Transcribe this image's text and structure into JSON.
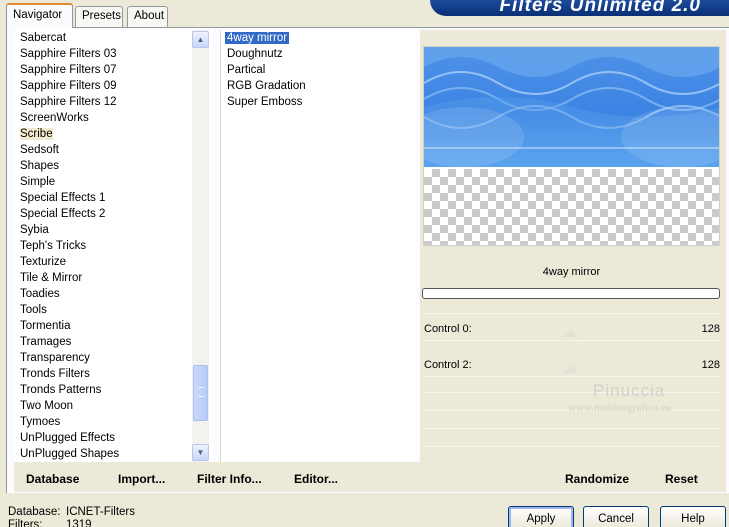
{
  "app": {
    "title": "Filters Unlimited 2.0"
  },
  "tabs": [
    {
      "label": "Navigator",
      "active": true
    },
    {
      "label": "Presets",
      "active": false
    },
    {
      "label": "About",
      "active": false
    }
  ],
  "categories": {
    "selected": "Scribe",
    "items": [
      "Sabercat",
      "Sapphire Filters 03",
      "Sapphire Filters 07",
      "Sapphire Filters 09",
      "Sapphire Filters 12",
      "ScreenWorks",
      "Scribe",
      "Sedsoft",
      "Shapes",
      "Simple",
      "Special Effects 1",
      "Special Effects 2",
      "Sybia",
      "Teph's Tricks",
      "Texturize",
      "Tile & Mirror",
      "Toadies",
      "Tools",
      "Tormentia",
      "Tramages",
      "Transparency",
      "Tronds Filters",
      "Tronds Patterns",
      "Two Moon",
      "Tymoes",
      "UnPlugged Effects",
      "UnPlugged Shapes"
    ]
  },
  "filters": {
    "selected": "4way mirror",
    "items": [
      "4way mirror",
      "Doughnutz",
      "Partical",
      "RGB Gradation",
      "Super Emboss"
    ]
  },
  "preview": {
    "filter_name": "4way mirror",
    "progress": 0,
    "controls": [
      {
        "label": "Control 0:",
        "value": "128"
      },
      {
        "label": "Control 2:",
        "value": "128"
      }
    ],
    "watermark": {
      "line1": "Pinuccia",
      "line2": "www.maidiregrafica.eu"
    }
  },
  "toolbar": {
    "database": "Database",
    "import": "Import...",
    "filter_info": "Filter Info...",
    "editor": "Editor...",
    "randomize": "Randomize",
    "reset": "Reset"
  },
  "info": {
    "database_label": "Database:",
    "database_value": "ICNET-Filters",
    "filters_label": "Filters:",
    "filters_value": "1319"
  },
  "dialog_buttons": {
    "apply": "Apply",
    "cancel": "Cancel",
    "help": "Help"
  },
  "colors": {
    "accent_tab": "#e68b2c",
    "selection": "#316ac5",
    "banner": "#0a2f74"
  }
}
